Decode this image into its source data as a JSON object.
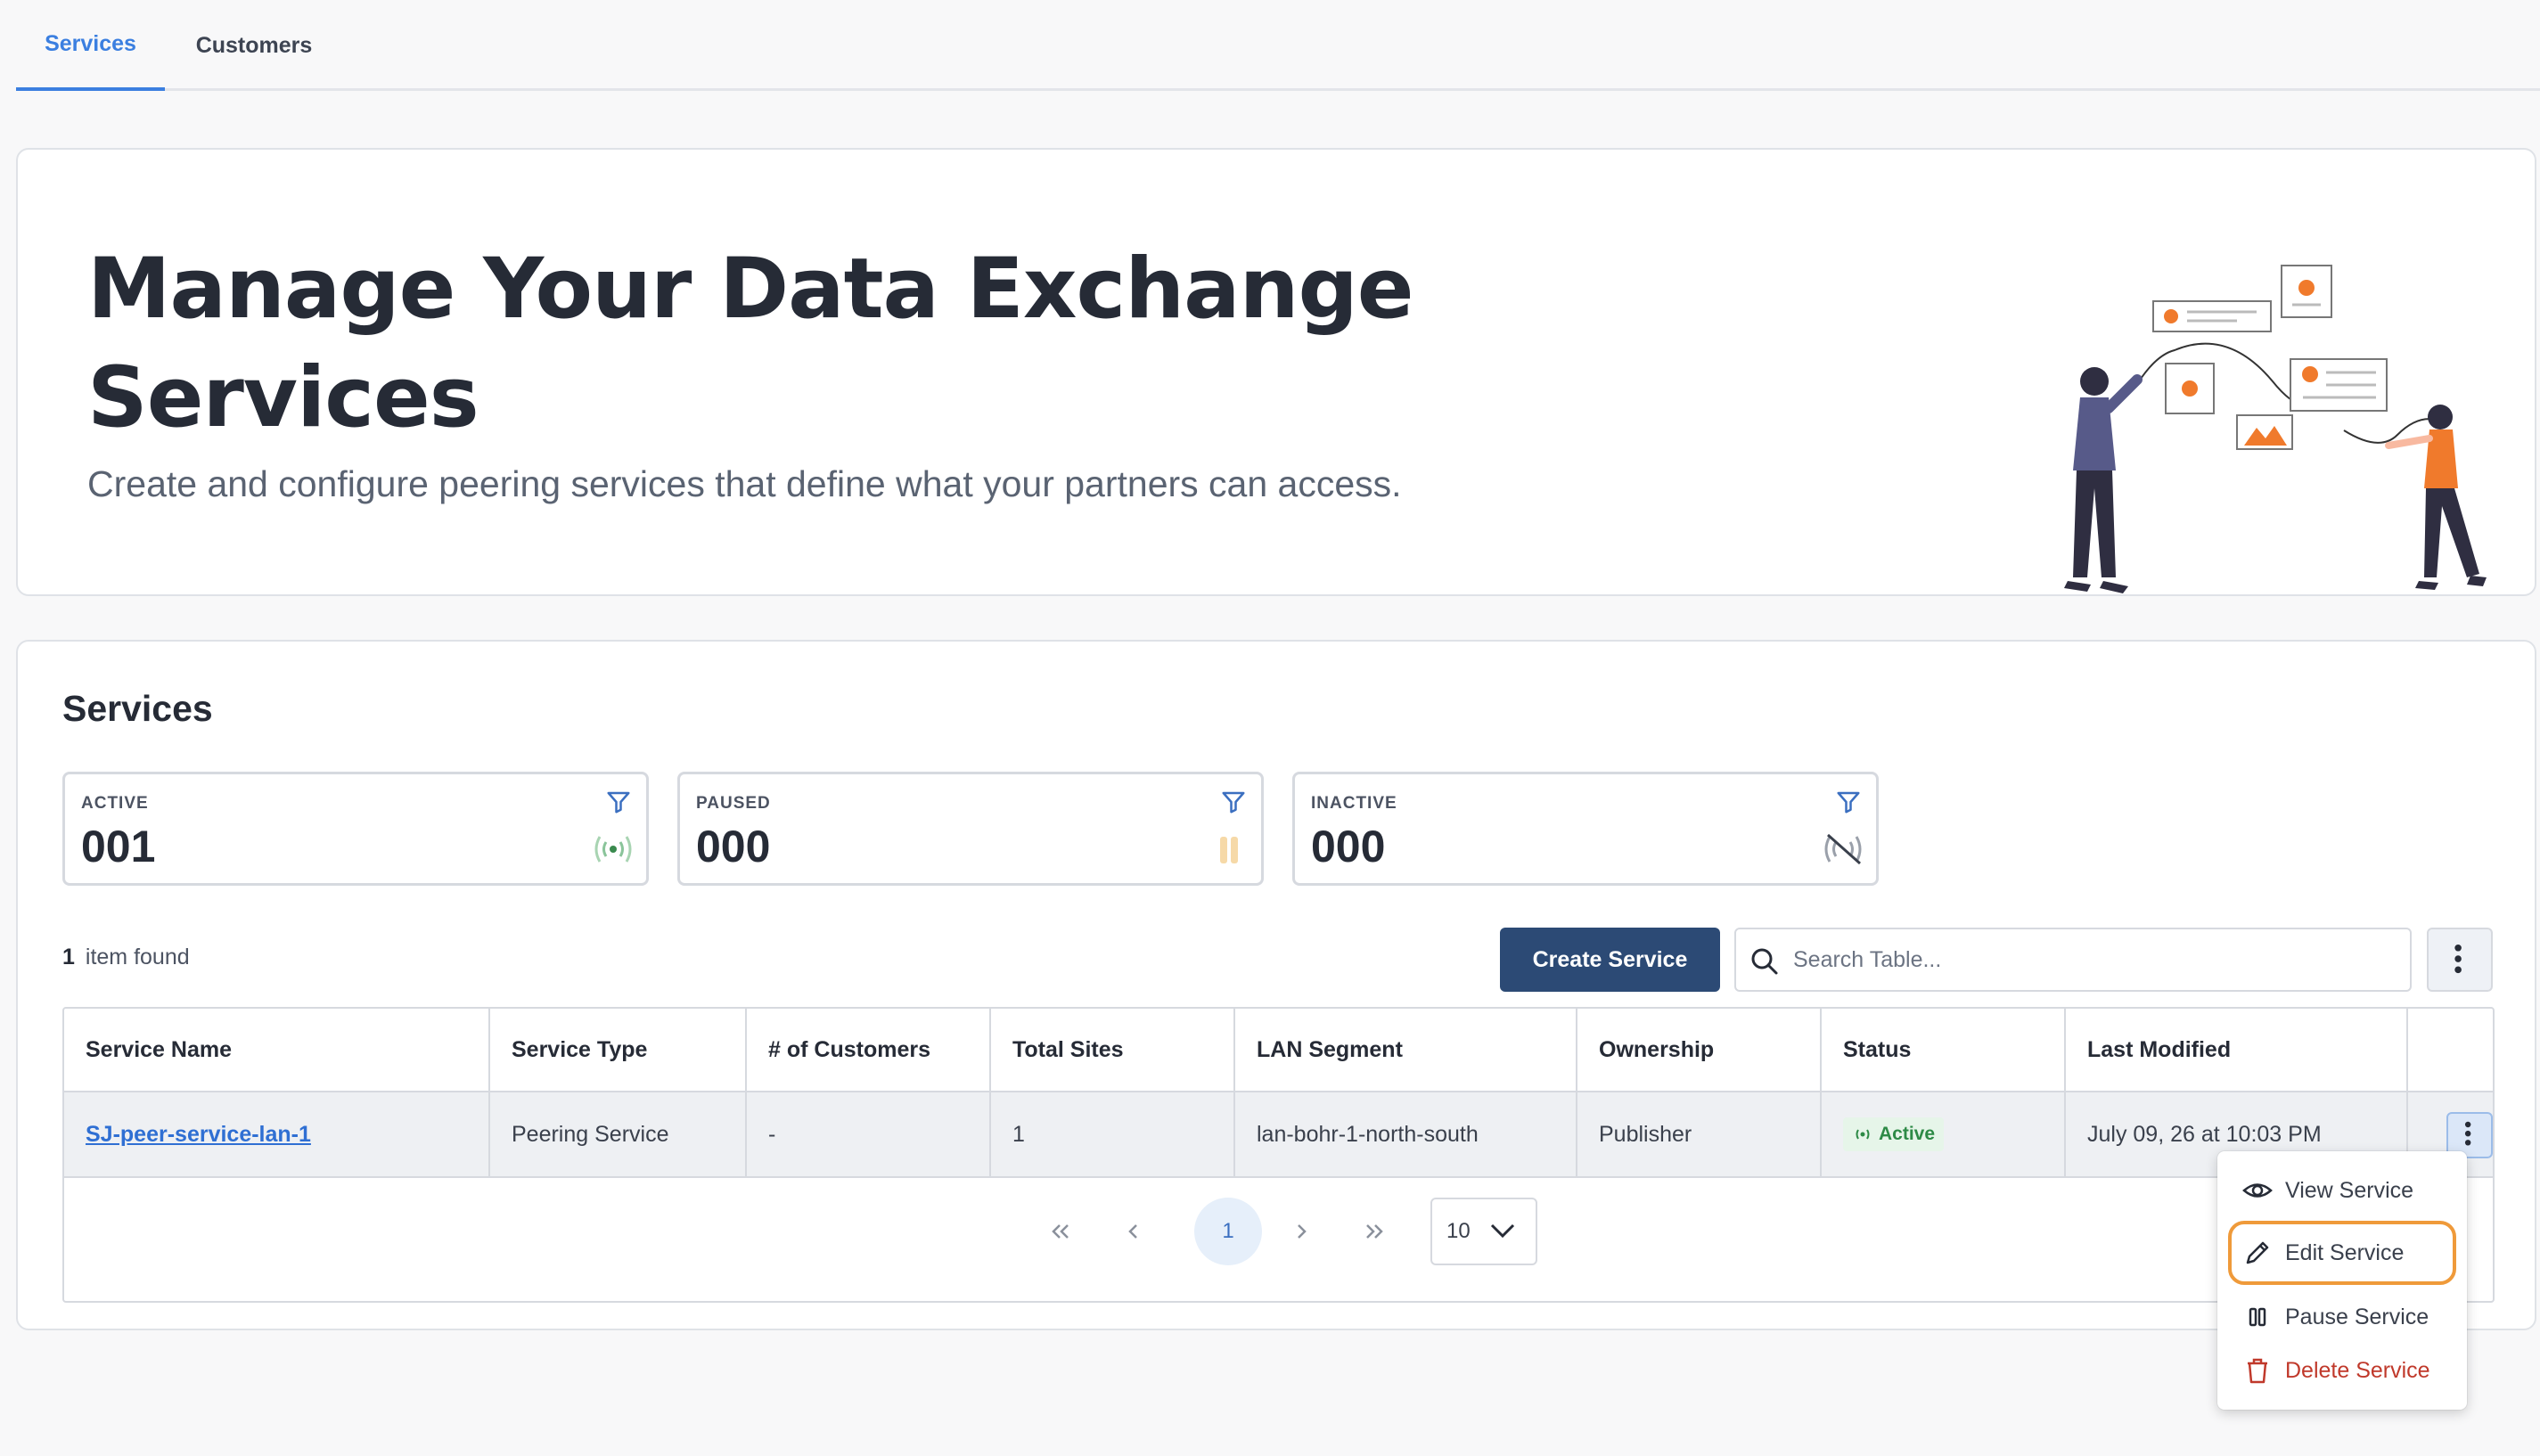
{
  "tabs": [
    {
      "label": "Services",
      "active": true
    },
    {
      "label": "Customers",
      "active": false
    }
  ],
  "hero": {
    "title": "Manage Your Data Exchange Services",
    "subtitle": "Create and configure peering services that define what your partners can access."
  },
  "services": {
    "title": "Services",
    "stats": [
      {
        "label": "ACTIVE",
        "value": "001",
        "icon": "broadcast-icon"
      },
      {
        "label": "PAUSED",
        "value": "000",
        "icon": "pause-icon"
      },
      {
        "label": "INACTIVE",
        "value": "000",
        "icon": "broadcast-off-icon"
      }
    ],
    "found_count": "1",
    "found_label": "item found",
    "create_label": "Create Service",
    "search_placeholder": "Search Table...",
    "table": {
      "columns": [
        "Service Name",
        "Service Type",
        "# of Customers",
        "Total Sites",
        "LAN Segment",
        "Ownership",
        "Status",
        "Last Modified"
      ],
      "rows": [
        {
          "name": "SJ-peer-service-lan-1",
          "type": "Peering Service",
          "customers": "-",
          "sites": "1",
          "lan": "lan-bohr-1-north-south",
          "ownership": "Publisher",
          "status": "Active",
          "modified": "July 09, 26 at 10:03 PM"
        }
      ]
    },
    "pagination": {
      "current_page": "1",
      "page_size": "10"
    }
  },
  "row_menu": {
    "items": [
      {
        "label": "View Service",
        "icon": "eye-icon"
      },
      {
        "label": "Edit Service",
        "icon": "pencil-icon",
        "focused": true
      },
      {
        "label": "Pause Service",
        "icon": "pause-icon"
      },
      {
        "label": "Delete Service",
        "icon": "trash-icon",
        "danger": true
      }
    ]
  },
  "colors": {
    "accent": "#3b7fe0",
    "primary_button": "#2c4a75",
    "illustration_orange": "#f07a2c",
    "active_green": "#2d8a46",
    "danger": "#c0392b",
    "focus_ring": "#ef9a3a"
  }
}
